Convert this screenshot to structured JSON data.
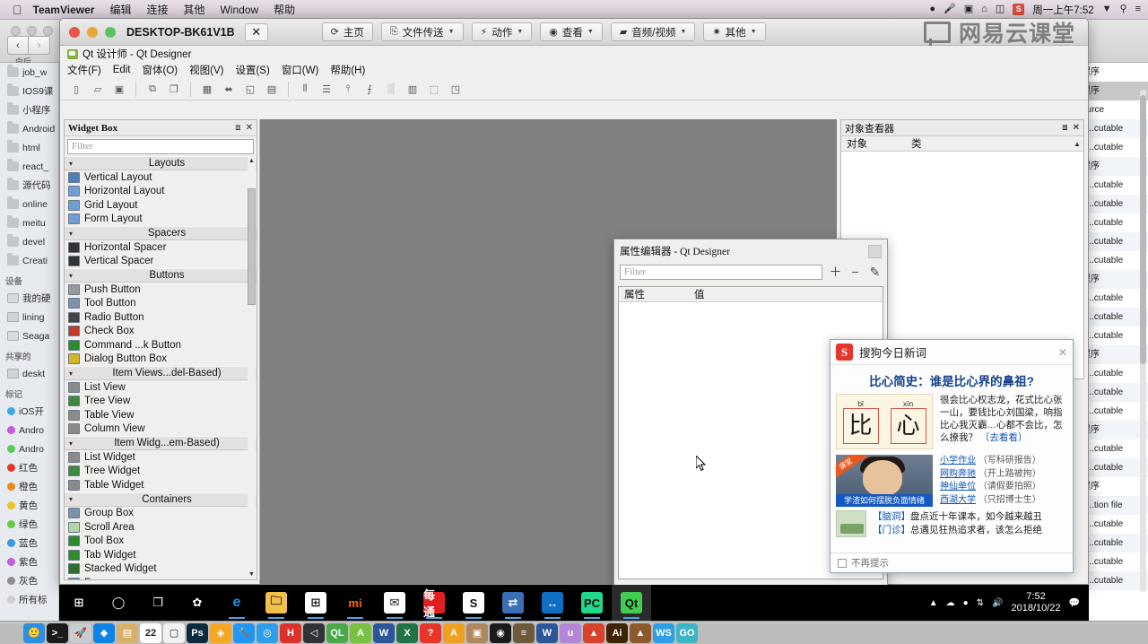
{
  "mac_menubar": {
    "apple_icon": "apple-icon",
    "items": [
      "TeamViewer",
      "编辑",
      "连接",
      "其他",
      "Window",
      "帮助"
    ],
    "status_icons": [
      "dropbox-icon",
      "microphone-icon",
      "screenshot-icon",
      "bluetooth-icon",
      "battery-icon",
      "sogou-input-icon"
    ],
    "clock": "周一上午7:52",
    "right_icons": [
      "wifi-icon",
      "search-icon",
      "control-center-icon"
    ]
  },
  "finder": {
    "back_label": "向后",
    "sidebar": {
      "favorites": [
        {
          "label": "job_w",
          "icon": "folder-icon"
        },
        {
          "label": "IOS9课",
          "icon": "folder-icon"
        },
        {
          "label": "小程序",
          "icon": "folder-icon"
        },
        {
          "label": "Android",
          "icon": "folder-icon"
        },
        {
          "label": "html",
          "icon": "folder-icon"
        },
        {
          "label": "react_",
          "icon": "folder-icon"
        },
        {
          "label": "源代码",
          "icon": "folder-icon"
        },
        {
          "label": "online",
          "icon": "folder-icon"
        },
        {
          "label": "meitu",
          "icon": "folder-icon"
        },
        {
          "label": "devel",
          "icon": "folder-icon"
        },
        {
          "label": "Creati",
          "icon": "folder-icon"
        }
      ],
      "devices_title": "设备",
      "devices": [
        {
          "label": "我的硬",
          "icon": "disk-icon"
        },
        {
          "label": "lining",
          "icon": "screen-icon"
        },
        {
          "label": "Seaga",
          "icon": "disk-icon"
        }
      ],
      "shared_title": "共享的",
      "shared": [
        {
          "label": "deskt",
          "icon": "screen-icon"
        }
      ],
      "tags_title": "标记",
      "tags": [
        {
          "label": "iOS开",
          "color": "#3ba7e8"
        },
        {
          "label": "Andro",
          "color": "#c05ae0"
        },
        {
          "label": "Andro",
          "color": "#5cc95c"
        },
        {
          "label": "红色",
          "color": "#e8352c"
        },
        {
          "label": "橙色",
          "color": "#e88a1e"
        },
        {
          "label": "黄色",
          "color": "#e8c820"
        },
        {
          "label": "绿色",
          "color": "#66cc48"
        },
        {
          "label": "蓝色",
          "color": "#3a9ae8"
        },
        {
          "label": "紫色",
          "color": "#c45ae0"
        },
        {
          "label": "灰色",
          "color": "#8e8e8e"
        },
        {
          "label": "所有标",
          "color": "#cfcfcf"
        }
      ]
    },
    "file_column": [
      {
        "label": "程序",
        "style": "plain"
      },
      {
        "label": "程序",
        "style": "selected"
      },
      {
        "label": "ource",
        "style": "plain"
      },
      {
        "label": "e...cutable",
        "style": "alt"
      },
      {
        "label": "e...cutable",
        "style": "plain"
      },
      {
        "label": "程序",
        "style": "alt"
      },
      {
        "label": "e...cutable",
        "style": "plain"
      },
      {
        "label": "e...cutable",
        "style": "alt"
      },
      {
        "label": "e...cutable",
        "style": "plain"
      },
      {
        "label": "e...cutable",
        "style": "alt"
      },
      {
        "label": "e...cutable",
        "style": "plain"
      },
      {
        "label": "程序",
        "style": "alt"
      },
      {
        "label": "e...cutable",
        "style": "plain"
      },
      {
        "label": "e...cutable",
        "style": "alt"
      },
      {
        "label": "e...cutable",
        "style": "plain"
      },
      {
        "label": "程序",
        "style": "alt"
      },
      {
        "label": "e...cutable",
        "style": "plain"
      },
      {
        "label": "e...cutable",
        "style": "alt"
      },
      {
        "label": "e...cutable",
        "style": "plain"
      },
      {
        "label": "程序",
        "style": "alt"
      },
      {
        "label": "e...cutable",
        "style": "plain"
      },
      {
        "label": "e...cutable",
        "style": "alt"
      },
      {
        "label": "程序",
        "style": "plain"
      },
      {
        "label": "g...tion file",
        "style": "alt"
      },
      {
        "label": "e...cutable",
        "style": "plain"
      },
      {
        "label": "e...cutable",
        "style": "alt"
      },
      {
        "label": "e...cutable",
        "style": "plain"
      },
      {
        "label": "e...cutable",
        "style": "alt"
      }
    ]
  },
  "teamviewer": {
    "host": "DESKTOP-BK61V1B",
    "close_label": "✕",
    "toolbar": [
      {
        "label": "主页",
        "icon": "home-icon",
        "caret": false
      },
      {
        "label": "文件传送",
        "icon": "file-transfer-icon",
        "caret": true
      },
      {
        "label": "动作",
        "icon": "lightning-icon",
        "caret": true
      },
      {
        "label": "查看",
        "icon": "eye-icon",
        "caret": true
      },
      {
        "label": "音频/视频",
        "icon": "chat-icon",
        "caret": true
      },
      {
        "label": "其他",
        "icon": "puzzle-icon",
        "caret": true
      }
    ],
    "watermark": "网易云课堂"
  },
  "qt_designer": {
    "window_title": "Qt 设计师 - Qt Designer",
    "menu": [
      "文件(F)",
      "Edit",
      "窗体(O)",
      "视图(V)",
      "设置(S)",
      "窗口(W)",
      "帮助(H)"
    ],
    "toolbar_icons": [
      "new-form-icon",
      "open-form-icon",
      "save-form-icon",
      "sep",
      "copy-icon",
      "paste-icon",
      "sep",
      "edit-widgets-icon",
      "edit-signals-icon",
      "edit-buddies-icon",
      "edit-tab-order-icon",
      "sep",
      "layout-horizontal-icon",
      "layout-vertical-icon",
      "layout-splitter-h-icon",
      "layout-splitter-v-icon",
      "layout-grid-icon",
      "layout-form-icon",
      "break-layout-icon",
      "adjust-size-icon"
    ],
    "widget_box": {
      "title": "Widget Box",
      "filter_placeholder": "Filter",
      "float_icon": "undock-icon",
      "close_icon": "close-icon",
      "groups": [
        {
          "name": "Layouts",
          "items": [
            {
              "label": "Vertical Layout",
              "icon": "vertical-layout-icon"
            },
            {
              "label": "Horizontal Layout",
              "icon": "horizontal-layout-icon"
            },
            {
              "label": "Grid Layout",
              "icon": "grid-layout-icon"
            },
            {
              "label": "Form Layout",
              "icon": "form-layout-icon"
            }
          ]
        },
        {
          "name": "Spacers",
          "items": [
            {
              "label": "Horizontal Spacer",
              "icon": "horizontal-spacer-icon"
            },
            {
              "label": "Vertical Spacer",
              "icon": "vertical-spacer-icon"
            }
          ]
        },
        {
          "name": "Buttons",
          "items": [
            {
              "label": "Push Button",
              "icon": "push-button-icon"
            },
            {
              "label": "Tool Button",
              "icon": "tool-button-icon"
            },
            {
              "label": "Radio Button",
              "icon": "radio-button-icon"
            },
            {
              "label": "Check Box",
              "icon": "check-box-icon"
            },
            {
              "label": "Command ...k Button",
              "icon": "command-link-button-icon"
            },
            {
              "label": "Dialog Button Box",
              "icon": "dialog-button-box-icon"
            }
          ]
        },
        {
          "name": "Item Views...del-Based)",
          "items": [
            {
              "label": "List View",
              "icon": "list-view-icon"
            },
            {
              "label": "Tree View",
              "icon": "tree-view-icon"
            },
            {
              "label": "Table View",
              "icon": "table-view-icon"
            },
            {
              "label": "Column View",
              "icon": "column-view-icon"
            }
          ]
        },
        {
          "name": "Item Widg...em-Based)",
          "items": [
            {
              "label": "List Widget",
              "icon": "list-widget-icon"
            },
            {
              "label": "Tree Widget",
              "icon": "tree-widget-icon"
            },
            {
              "label": "Table Widget",
              "icon": "table-widget-icon"
            }
          ]
        },
        {
          "name": "Containers",
          "items": [
            {
              "label": "Group Box",
              "icon": "group-box-icon"
            },
            {
              "label": "Scroll Area",
              "icon": "scroll-area-icon"
            },
            {
              "label": "Tool Box",
              "icon": "tool-box-icon"
            },
            {
              "label": "Tab Widget",
              "icon": "tab-widget-icon"
            },
            {
              "label": "Stacked Widget",
              "icon": "stacked-widget-icon"
            },
            {
              "label": "Frame",
              "icon": "frame-icon"
            }
          ]
        }
      ]
    },
    "object_inspector": {
      "title": "对象查看器",
      "columns": [
        "对象",
        "类"
      ],
      "float_icon": "undock-icon",
      "close_icon": "close-icon"
    },
    "property_editor": {
      "title": "属性编辑器 - Qt Designer",
      "filter_placeholder": "Filter",
      "columns": [
        "属性",
        "值"
      ],
      "buttons": [
        "add-icon",
        "remove-icon",
        "configure-icon"
      ],
      "status": "值"
    }
  },
  "sogou_popup": {
    "brand": "搜狗今日新词",
    "logo_text": "S",
    "close_icon": "close-icon",
    "headline": "比心简史：谁是比心界的鼻祖?",
    "chars": [
      {
        "pinyin": "bǐ",
        "glyph": "比"
      },
      {
        "pinyin": "xīn",
        "glyph": "心"
      }
    ],
    "description": "很会比心权志龙，花式比心张一山，要钱比心刘国梁，响指比心我灭霸…心都不会比，怎么撩我？",
    "description_link": "〔去看看〕",
    "photo_tag": "课堂",
    "photo_caption": "学渣如何摆脱负面情绪",
    "links": [
      {
        "title": "小学作业",
        "note": "（写科研报告）"
      },
      {
        "title": "网购奔驰",
        "note": "（开上路被拘）"
      },
      {
        "title": "神仙单位",
        "note": "（请假要拍照）"
      },
      {
        "title": "西湖大学",
        "note": "（只招博士生）"
      }
    ],
    "news": [
      {
        "tag": "【脑洞】",
        "text": "盘点近十年课本，如今越来越丑"
      },
      {
        "tag": "【门诊】",
        "text": "总遇见狂热追求者，该怎么拒绝"
      }
    ],
    "footer_checkbox": "不再提示"
  },
  "windows_taskbar": {
    "items": [
      {
        "name": "start-button",
        "icon": "windows-icon",
        "color": "#000000",
        "glyph": "⊞"
      },
      {
        "name": "cortana-button",
        "icon": "cortana-circle-icon",
        "color": "#000000",
        "glyph": "◯"
      },
      {
        "name": "task-view-button",
        "icon": "task-view-icon",
        "color": "#000000",
        "glyph": "❐"
      },
      {
        "name": "app-fan",
        "icon": "fan-app-icon",
        "color": "#000000",
        "glyph": "✿"
      },
      {
        "name": "app-edge",
        "icon": "edge-icon",
        "color": "#000000",
        "glyph": "e"
      },
      {
        "name": "app-explorer",
        "icon": "file-explorer-icon",
        "color": "#f0c04a",
        "glyph": "🗀"
      },
      {
        "name": "app-store",
        "icon": "microsoft-store-icon",
        "color": "#ffffff",
        "glyph": "⊞"
      },
      {
        "name": "app-mi",
        "icon": "mi-icon",
        "color": "#000000",
        "glyph": "mi"
      },
      {
        "name": "app-mail",
        "icon": "mail-icon",
        "color": "#ffffff",
        "glyph": "✉"
      },
      {
        "name": "app-meitu",
        "icon": "meitu-icon",
        "color": "#e02020",
        "glyph": "每通"
      },
      {
        "name": "app-sogou",
        "icon": "sogou-browser-icon",
        "color": "#ffffff",
        "glyph": "S"
      },
      {
        "name": "app-ftp",
        "icon": "ftp-icon",
        "color": "#3b6fb5",
        "glyph": "⇄"
      },
      {
        "name": "app-teamviewer",
        "icon": "teamviewer-icon",
        "color": "#0e6fc4",
        "glyph": "↔"
      },
      {
        "name": "app-pycharm",
        "icon": "pycharm-icon",
        "color": "#21d789",
        "glyph": "PC"
      },
      {
        "name": "app-qt-designer",
        "icon": "qt-designer-icon",
        "color": "#41cd52",
        "glyph": "Qt"
      }
    ],
    "tray_icons": [
      "show-hidden-icons",
      "onedrive-icon",
      "sogou-input-icon",
      "network-icon",
      "volume-icon"
    ],
    "clock_time": "7:52",
    "clock_date": "2018/10/22",
    "action_center_icon": "action-center-icon"
  },
  "mac_dock": {
    "items": [
      {
        "name": "finder",
        "glyph": "🙂",
        "color": "#2d8fe0"
      },
      {
        "name": "terminal",
        "glyph": ">_",
        "color": "#1a1a1a"
      },
      {
        "name": "launchpad",
        "glyph": "🚀",
        "color": "#c8cdd4"
      },
      {
        "name": "dropbox",
        "glyph": "◆",
        "color": "#0f82e6"
      },
      {
        "name": "notes",
        "glyph": "▤",
        "color": "#d8b06a"
      },
      {
        "name": "calendar",
        "glyph": "22",
        "color": "#ffffff"
      },
      {
        "name": "textedit",
        "glyph": "▢",
        "color": "#f2f2f2"
      },
      {
        "name": "photoshop",
        "glyph": "Ps",
        "color": "#0b2a3c"
      },
      {
        "name": "sketch",
        "glyph": "◈",
        "color": "#f5a623"
      },
      {
        "name": "xcode",
        "glyph": "🔨",
        "color": "#2196f3"
      },
      {
        "name": "safari",
        "glyph": "◎",
        "color": "#2d9fe8"
      },
      {
        "name": "hbuilder",
        "glyph": "H",
        "color": "#d9332b"
      },
      {
        "name": "unity",
        "glyph": "◁",
        "color": "#2f3337"
      },
      {
        "name": "navicat",
        "glyph": "QL",
        "color": "#4aa84a"
      },
      {
        "name": "android-studio",
        "glyph": "A",
        "color": "#7ac143"
      },
      {
        "name": "word",
        "glyph": "W",
        "color": "#2b579a"
      },
      {
        "name": "excel",
        "glyph": "X",
        "color": "#217346"
      },
      {
        "name": "question-app",
        "glyph": "?",
        "color": "#e8352c"
      },
      {
        "name": "app-store",
        "glyph": "A",
        "color": "#f0a020"
      },
      {
        "name": "preview",
        "glyph": "▣",
        "color": "#b08860"
      },
      {
        "name": "zip",
        "glyph": "◉",
        "color": "#1a1a1a"
      },
      {
        "name": "database",
        "glyph": "≡",
        "color": "#6d5a3c"
      },
      {
        "name": "word2",
        "glyph": "W",
        "color": "#2b579a"
      },
      {
        "name": "sublime",
        "glyph": "u",
        "color": "#b387d6"
      },
      {
        "name": "matlab",
        "glyph": "▲",
        "color": "#d9432b"
      },
      {
        "name": "illustrator",
        "glyph": "Ai",
        "color": "#3d2200"
      },
      {
        "name": "mountain-app",
        "glyph": "▲",
        "color": "#8c5a2b"
      },
      {
        "name": "webstorm",
        "glyph": "WS",
        "color": "#2d9fe8"
      },
      {
        "name": "goland",
        "glyph": "GO",
        "color": "#3ab6c4"
      }
    ]
  }
}
